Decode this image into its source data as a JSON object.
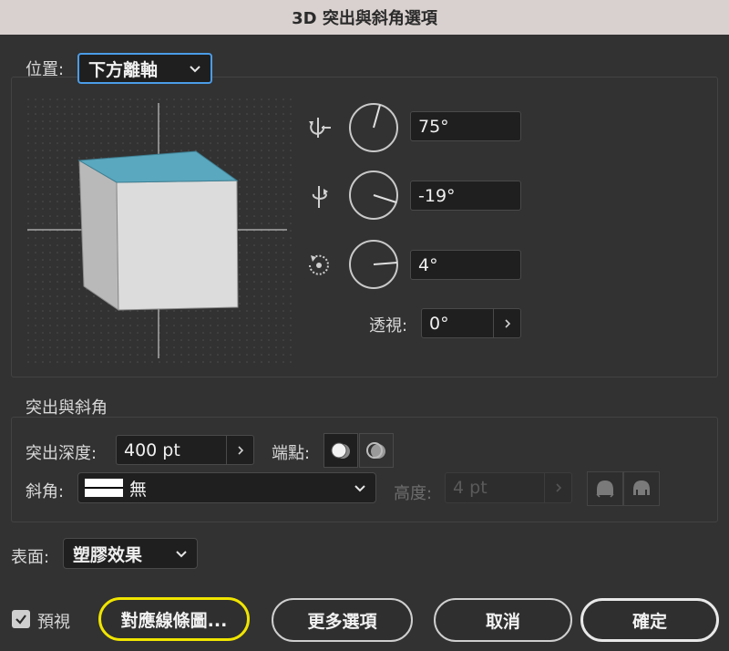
{
  "window": {
    "title": "3D 突出與斜角選項"
  },
  "position": {
    "label": "位置:",
    "selected": "下方離軸",
    "rotation_x": "75°",
    "rotation_y": "-19°",
    "rotation_z": "4°",
    "perspective_label": "透視:",
    "perspective_value": "0°"
  },
  "extrude": {
    "section_title": "突出與斜角",
    "depth_label": "突出深度:",
    "depth_value": "400 pt",
    "cap_label": "端點:",
    "bevel_label": "斜角:",
    "bevel_value": "無",
    "height_label": "高度:",
    "height_value": "4 pt"
  },
  "surface": {
    "label": "表面:",
    "selected": "塑膠效果"
  },
  "footer": {
    "preview_label": "預視",
    "preview_checked": true,
    "map_art_button": "對應線條圖...",
    "more_options_button": "更多選項",
    "cancel_button": "取消",
    "ok_button": "確定"
  },
  "colors": {
    "cube_top": "#5aa8bf",
    "focus_ring": "#4b9ce8",
    "highlight_ring": "#f0e500"
  }
}
